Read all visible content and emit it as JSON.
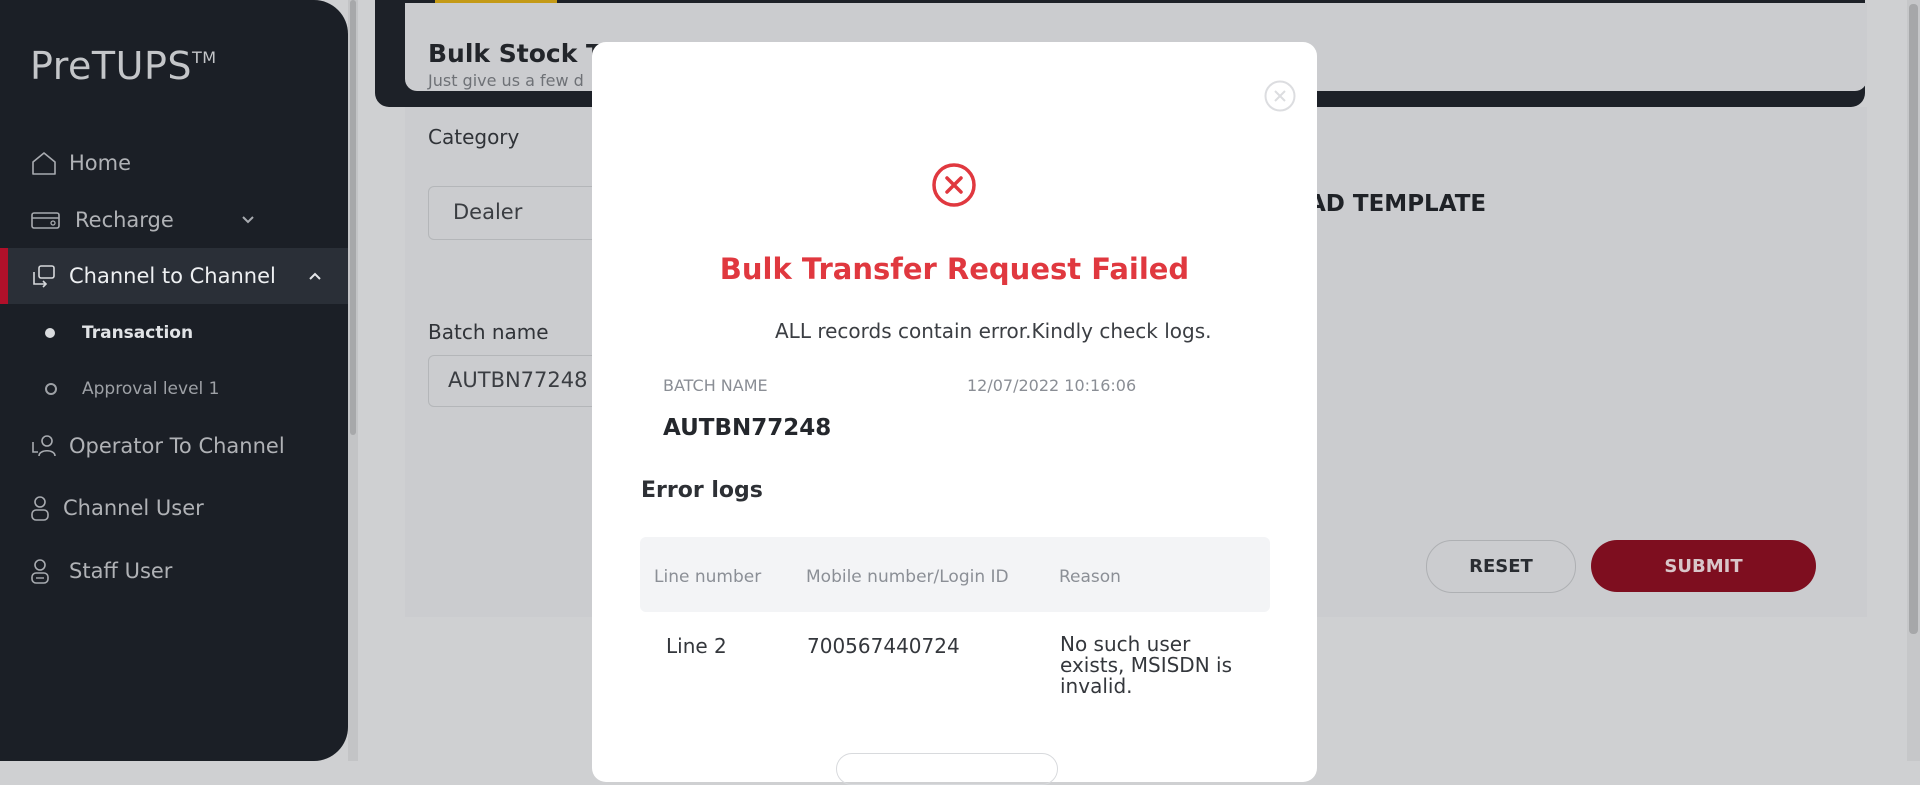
{
  "sidebar": {
    "logo": "PreTUPS",
    "logo_tm": "TM",
    "items": [
      {
        "label": "Home",
        "icon": "home-icon"
      },
      {
        "label": "Recharge",
        "icon": "recharge-icon"
      },
      {
        "label": "Channel to Channel",
        "icon": "channel-transfer-icon"
      },
      {
        "label": "Operator To Channel",
        "icon": "operator-transfer-icon"
      },
      {
        "label": "Channel User",
        "icon": "user-icon"
      },
      {
        "label": "Staff User",
        "icon": "staff-user-icon"
      }
    ],
    "sub_items": [
      {
        "label": "Transaction",
        "selected": true
      },
      {
        "label": "Approval level 1",
        "selected": false
      }
    ]
  },
  "page": {
    "title": "Bulk Stock Tra",
    "subtitle": "Just give us a few d",
    "category_label": "Category",
    "category_value": "Dealer",
    "batch_label": "Batch name",
    "batch_value": "AUTBN77248",
    "template_text": "AD TEMPLATE",
    "reset_label": "RESET",
    "submit_label": "SUBMIT"
  },
  "modal": {
    "title": "Bulk Transfer Request Failed",
    "message": "ALL records contain error.Kindly check logs.",
    "batch_name_label": "BATCH NAME",
    "timestamp": "12/07/2022 10:16:06",
    "batch_name_value": "AUTBN77248",
    "error_logs_heading": "Error logs",
    "table": {
      "headers": [
        "Line number",
        "Mobile number/Login ID",
        "Reason"
      ],
      "rows": [
        {
          "line": "Line 2",
          "mobile": "700567440724",
          "reason": "No such user exists, MSISDN is invalid."
        }
      ]
    }
  },
  "colors": {
    "sidebar_bg": "#1b1f26",
    "accent_red": "#b0102a",
    "error_red": "#e0383f",
    "submit_bg": "#7e0e1f",
    "overlay_bg": "#cfd0d2"
  }
}
